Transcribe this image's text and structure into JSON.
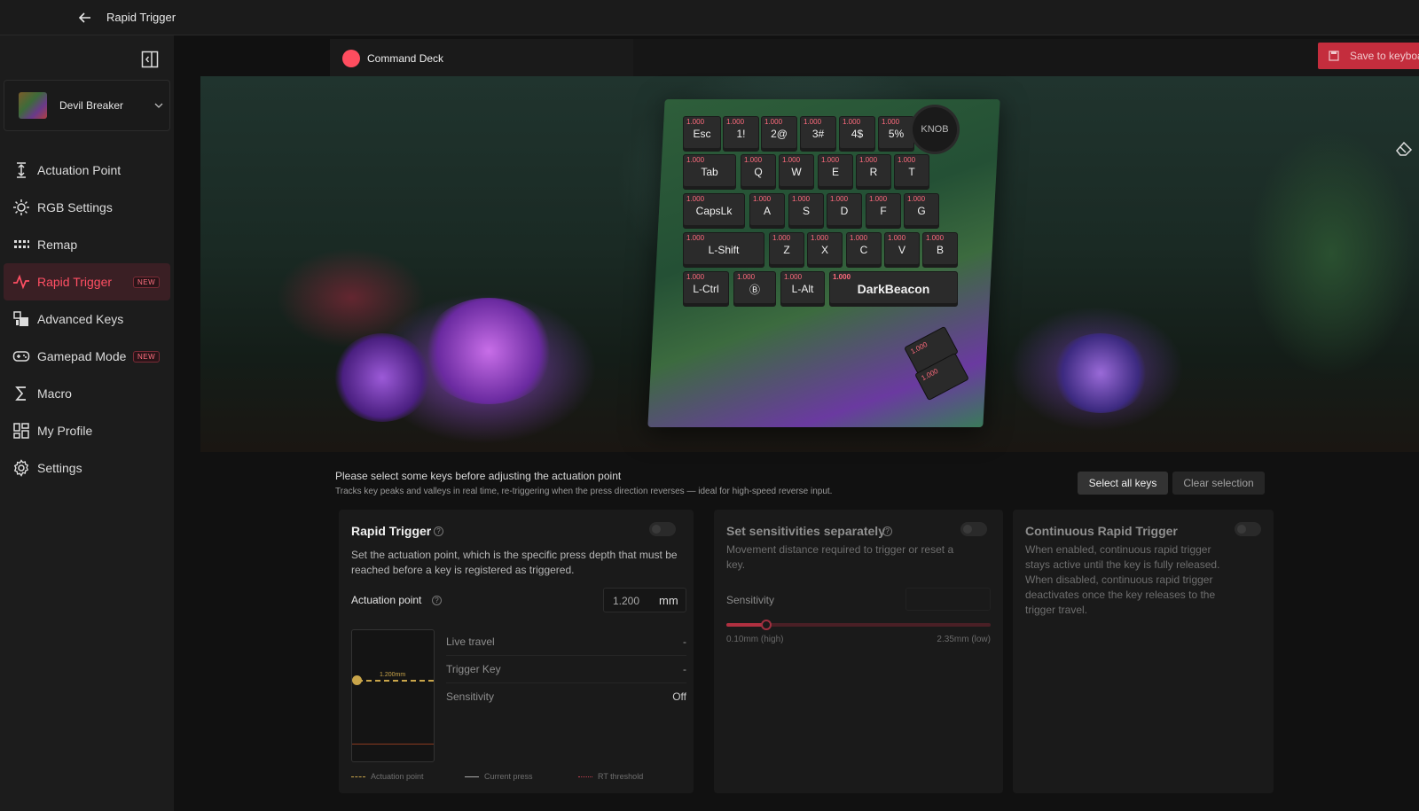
{
  "topbar": {
    "title": "Rapid Trigger"
  },
  "device": {
    "name": "Devil Breaker"
  },
  "nav": {
    "items": [
      {
        "label": "Actuation Point",
        "icon": "actuation-icon"
      },
      {
        "label": "RGB Settings",
        "icon": "sun-icon"
      },
      {
        "label": "Remap",
        "icon": "grid-dots-icon"
      },
      {
        "label": "Rapid Trigger",
        "icon": "pulse-icon",
        "badge": "NEW",
        "active": true
      },
      {
        "label": "Advanced Keys",
        "icon": "keys-icon"
      },
      {
        "label": "Gamepad Mode",
        "icon": "gamepad-icon",
        "badge": "NEW"
      },
      {
        "label": "Macro",
        "icon": "sigma-icon"
      },
      {
        "label": "My Profile",
        "icon": "profile-grid-icon"
      },
      {
        "label": "Settings",
        "icon": "gear-icon"
      }
    ]
  },
  "tab": {
    "name": "Command Deck"
  },
  "save_label": "Save to keyboard",
  "keyboard": {
    "default_value": "1.000",
    "knob_label": "KNOB",
    "rows": [
      [
        "Esc",
        "1!",
        "2@",
        "3#",
        "4$",
        "5%"
      ],
      [
        "Tab",
        "Q",
        "W",
        "E",
        "R",
        "T"
      ],
      [
        "CapsLk",
        "A",
        "S",
        "D",
        "F",
        "G"
      ],
      [
        "L-Shift",
        "Z",
        "X",
        "C",
        "V",
        "B"
      ],
      [
        "L-Ctrl",
        "",
        "L-Alt",
        "DarkBeacon"
      ]
    ]
  },
  "hint": {
    "title": "Please select some keys before adjusting the actuation point",
    "subtitle": "Tracks key peaks and valleys in real time, re-triggering when the press direction reverses — ideal for high-speed reverse input."
  },
  "buttons": {
    "select_all": "Select all keys",
    "clear": "Clear selection"
  },
  "rapid_trigger": {
    "title": "Rapid Trigger",
    "desc": "Set the actuation point, which is the specific press depth that must be reached before a key is registered as triggered.",
    "actuation_label": "Actuation point",
    "actuation_value": "1.200",
    "unit": "mm",
    "graph_label": "1.200mm",
    "stats": [
      {
        "k": "Live travel",
        "v": "-"
      },
      {
        "k": "Trigger Key",
        "v": "-"
      },
      {
        "k": "Sensitivity",
        "v": "Off"
      }
    ],
    "legend": [
      "Actuation point",
      "Current press",
      "RT threshold"
    ]
  },
  "separate": {
    "title": "Set sensitivities separately",
    "desc": "Movement distance required to trigger or reset a key.",
    "sens_label": "Sensitivity",
    "slider_value": 0.15,
    "min_label": "0.10mm (high)",
    "max_label": "2.35mm (low)"
  },
  "continuous": {
    "title": "Continuous Rapid Trigger",
    "desc": "When enabled, continuous rapid trigger stays active until the key is fully released. When disabled, continuous rapid trigger deactivates once the key releases to the trigger travel."
  },
  "colors": {
    "accent": "#ff4f63",
    "save_bg": "#c42d3d",
    "gold": "#c9a54a"
  }
}
